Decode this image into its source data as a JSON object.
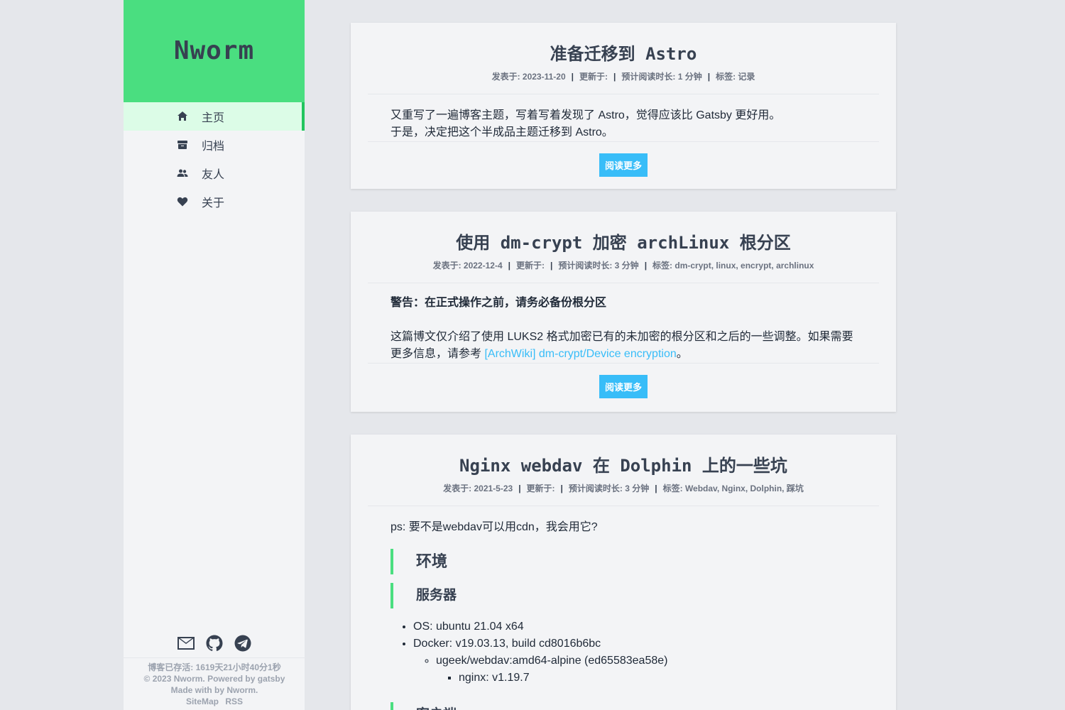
{
  "sidebar": {
    "brand": "Nworm",
    "nav": [
      {
        "label": "主页",
        "icon": "home-icon"
      },
      {
        "label": "归档",
        "icon": "archive-icon"
      },
      {
        "label": "友人",
        "icon": "friends-icon"
      },
      {
        "label": "关于",
        "icon": "heart-icon"
      }
    ],
    "social": [
      "mail-icon",
      "github-icon",
      "telegram-icon"
    ],
    "footer": {
      "uptime": "博客已存活: 1619天21小时40分1秒",
      "copyright": "© 2023 Nworm. Powered by gatsby",
      "made": "Made with by Nworm.",
      "links": [
        "SiteMap",
        "RSS"
      ]
    }
  },
  "colors": {
    "accent": "#4ade80",
    "link": "#38bdf8",
    "active_bg": "#dcfce7"
  },
  "posts": [
    {
      "title": "准备迁移到 Astro",
      "published": "发表于: 2023-11-20",
      "updated": "更新于:",
      "reading": "预计阅读时长: 1 分钟",
      "tags": "标签: 记录",
      "lines": [
        "又重写了一遍博客主题，写着写着发现了 Astro，觉得应该比 Gatsby 更好用。",
        "于是，决定把这个半成品主题迁移到 Astro。"
      ],
      "read_more": "阅读更多"
    },
    {
      "title": "使用 dm-crypt 加密 archLinux 根分区",
      "published": "发表于: 2022-12-4",
      "updated": "更新于:",
      "reading": "预计阅读时长: 3 分钟",
      "tags": "标签: dm-crypt, linux, encrypt, archlinux",
      "warning": "警告：在正式操作之前，请务必备份根分区",
      "line1": "这篇博文仅介绍了使用 LUKS2 格式加密已有的未加密的根分区和之后的一些调整。如果需要",
      "line2_prefix": "更多信息，请参考 ",
      "link": "[ArchWiki] dm-crypt/Device encryption",
      "line2_suffix": "。",
      "read_more": "阅读更多"
    },
    {
      "title": "Nginx webdav 在 Dolphin 上的一些坑",
      "published": "发表于: 2021-5-23",
      "updated": "更新于:",
      "reading": "预计阅读时长: 3 分钟",
      "tags": "标签: Webdav, Nginx, Dolphin, 踩坑",
      "intro": "ps: 要不是webdav可以用cdn，我会用它?",
      "h2": "环境",
      "h3": "服务器",
      "items": [
        "OS: ubuntu 21.04 x64",
        "Docker: v19.03.13, build cd8016b6bc"
      ],
      "sub_item": "ugeek/webdav:amd64-alpine (ed65583ea58e)",
      "sub_sub_item": "nginx: v1.19.7",
      "h3_next": "客户端"
    }
  ]
}
